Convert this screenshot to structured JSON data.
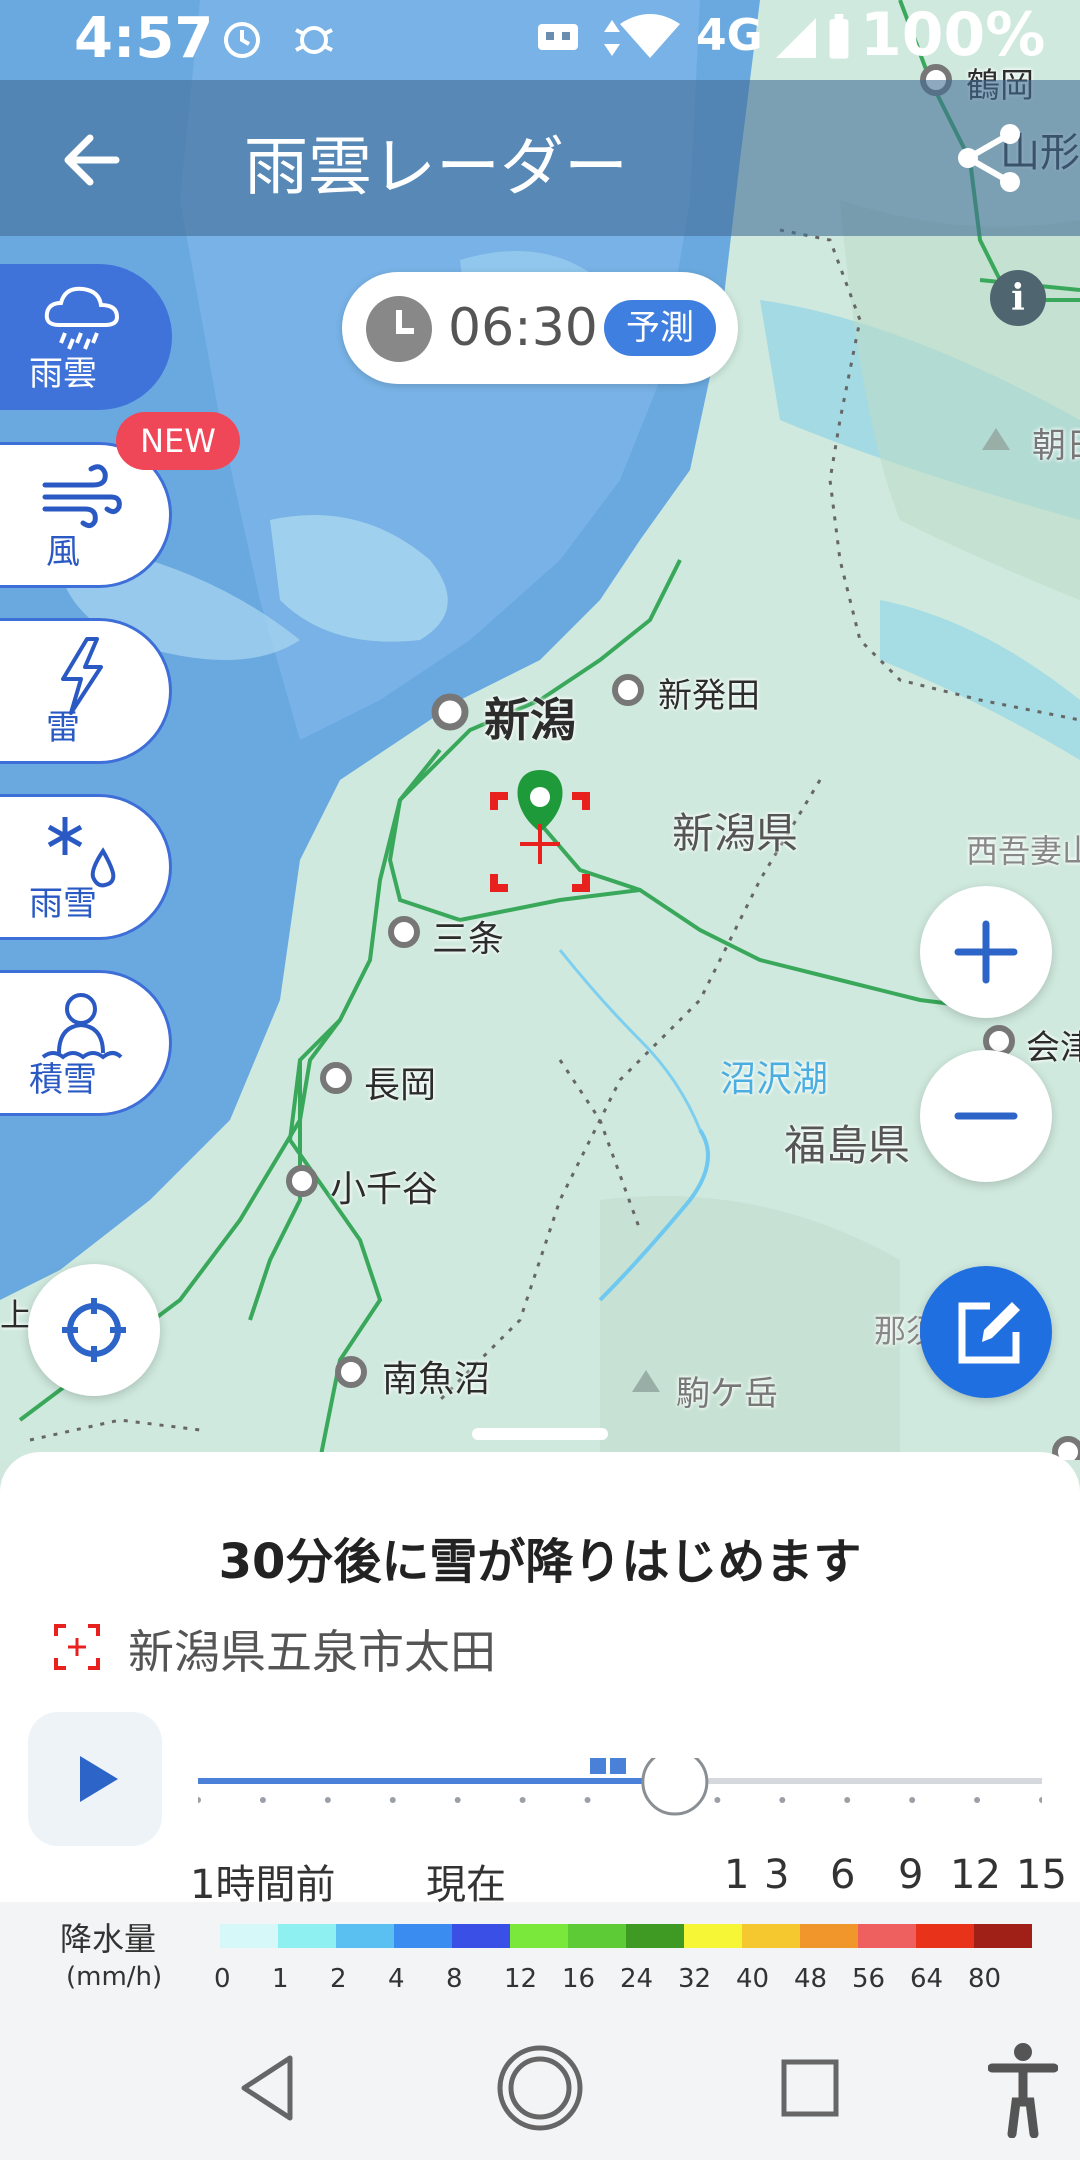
{
  "status_bar": {
    "time": "4:57",
    "network": "4G",
    "battery": "100%"
  },
  "app_bar": {
    "title": "雨雲レーダー",
    "back_icon": "arrow-left-icon",
    "share_icon": "share-icon"
  },
  "layers": [
    {
      "label": "雨雲",
      "icon": "cloud-rain-icon",
      "active": true
    },
    {
      "label": "風",
      "icon": "wind-icon",
      "active": false
    },
    {
      "label": "雷",
      "icon": "lightning-icon",
      "active": false
    },
    {
      "label": "雨雪",
      "icon": "snow-rain-icon",
      "active": false
    },
    {
      "label": "積雪",
      "icon": "snowman-icon",
      "active": false
    }
  ],
  "new_badge": "NEW",
  "time_chip": {
    "time": "06:30",
    "tag": "予測"
  },
  "info_icon": "i",
  "map": {
    "places": [
      {
        "name": "鶴岡"
      },
      {
        "name": "山形"
      },
      {
        "name": "朝日"
      },
      {
        "name": "新発田"
      },
      {
        "name": "新潟"
      },
      {
        "name": "新潟県"
      },
      {
        "name": "西吾妻山"
      },
      {
        "name": "三条"
      },
      {
        "name": "会津"
      },
      {
        "name": "長岡"
      },
      {
        "name": "沼沢湖"
      },
      {
        "name": "福島県"
      },
      {
        "name": "小千谷"
      },
      {
        "name": "上越"
      },
      {
        "name": "那須"
      },
      {
        "name": "南魚沼"
      },
      {
        "name": "駒ケ岳"
      }
    ]
  },
  "forecast": {
    "headline": "30分後に雪が降りはじめます",
    "location": "新潟県五泉市太田"
  },
  "timeline": {
    "labels": [
      "1時間前",
      "現在",
      "1",
      "3",
      "6",
      "9",
      "12",
      "15"
    ],
    "position_fraction": 0.565
  },
  "legend": {
    "title": "降水量",
    "unit": "(mm/h)",
    "ticks": [
      "0",
      "1",
      "2",
      "4",
      "8",
      "12",
      "16",
      "24",
      "32",
      "40",
      "48",
      "56",
      "64",
      "80"
    ],
    "colors": [
      "#d6f8f8",
      "#8ef0f0",
      "#5ac0f2",
      "#3a8cf0",
      "#3a4fe6",
      "#7ae83a",
      "#5ccb36",
      "#3f9a24",
      "#f6f636",
      "#f6c830",
      "#f0962a",
      "#ee6060",
      "#e8321a",
      "#a02018"
    ]
  },
  "nav_bar": {
    "back": "nav-back-icon",
    "home": "nav-home-icon",
    "recents": "nav-recents-icon",
    "accessibility": "accessibility-icon"
  }
}
